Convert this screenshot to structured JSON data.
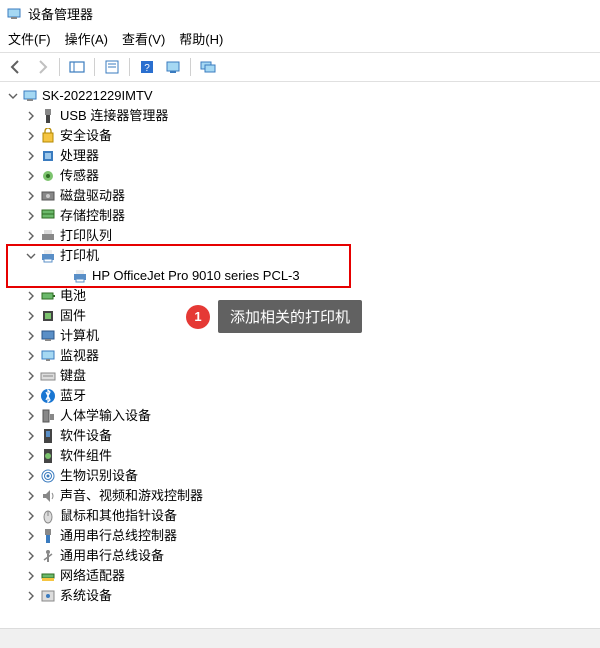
{
  "window": {
    "title": "设备管理器"
  },
  "menu": [
    {
      "label": "文件(F)"
    },
    {
      "label": "操作(A)"
    },
    {
      "label": "查看(V)"
    },
    {
      "label": "帮助(H)"
    }
  ],
  "toolbar": [
    {
      "name": "back"
    },
    {
      "name": "forward"
    },
    {
      "name": "show-hide-tree"
    },
    {
      "name": "properties"
    },
    {
      "name": "help"
    },
    {
      "name": "scan-hardware"
    },
    {
      "name": "monitor-devices"
    }
  ],
  "root": {
    "label": "SK-20221229IMTV"
  },
  "devices": [
    {
      "icon": "usb",
      "label": "USB 连接器管理器"
    },
    {
      "icon": "security",
      "label": "安全设备"
    },
    {
      "icon": "cpu",
      "label": "处理器"
    },
    {
      "icon": "sensor",
      "label": "传感器"
    },
    {
      "icon": "disk",
      "label": "磁盘驱动器"
    },
    {
      "icon": "storage",
      "label": "存储控制器"
    },
    {
      "icon": "printq",
      "label": "打印队列"
    },
    {
      "icon": "printer",
      "label": "打印机",
      "expanded": true,
      "highlighted": true,
      "children": [
        {
          "icon": "printer",
          "label": "HP OfficeJet Pro 9010 series PCL-3"
        }
      ]
    },
    {
      "icon": "battery",
      "label": "电池"
    },
    {
      "icon": "firmware",
      "label": "固件"
    },
    {
      "icon": "computer",
      "label": "计算机"
    },
    {
      "icon": "monitor",
      "label": "监视器"
    },
    {
      "icon": "keyboard",
      "label": "键盘"
    },
    {
      "icon": "bluetooth",
      "label": "蓝牙"
    },
    {
      "icon": "hid",
      "label": "人体学输入设备"
    },
    {
      "icon": "software",
      "label": "软件设备"
    },
    {
      "icon": "component",
      "label": "软件组件"
    },
    {
      "icon": "biometric",
      "label": "生物识别设备"
    },
    {
      "icon": "audio",
      "label": "声音、视频和游戏控制器"
    },
    {
      "icon": "mouse",
      "label": "鼠标和其他指针设备"
    },
    {
      "icon": "usbctrl",
      "label": "通用串行总线控制器"
    },
    {
      "icon": "usbdev",
      "label": "通用串行总线设备"
    },
    {
      "icon": "network",
      "label": "网络适配器"
    },
    {
      "icon": "system",
      "label": "系统设备"
    }
  ],
  "callout": {
    "number": "1",
    "text": "添加相关的打印机"
  },
  "colors": {
    "highlight": "#e60000",
    "badge": "#e53935",
    "tooltip": "#616161"
  }
}
